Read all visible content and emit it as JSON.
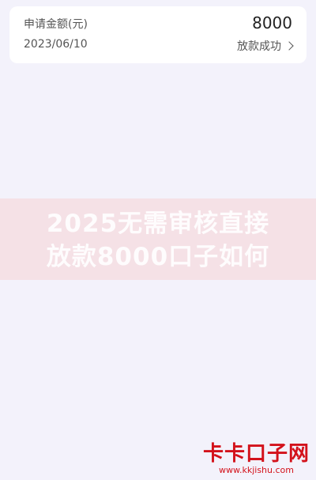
{
  "card": {
    "label": "申请金额(元)",
    "amount": "8000",
    "date": "2023/06/10",
    "status": "放款成功"
  },
  "watermark": {
    "line1": "2025无需审核直接",
    "line2": "放款8000口子如何"
  },
  "logo": {
    "main": "卡卡口子网",
    "url": "www.kkjishu.com"
  },
  "colors": {
    "background": "#f3f2fb",
    "card": "#ffffff",
    "logo": "#d3121b"
  }
}
